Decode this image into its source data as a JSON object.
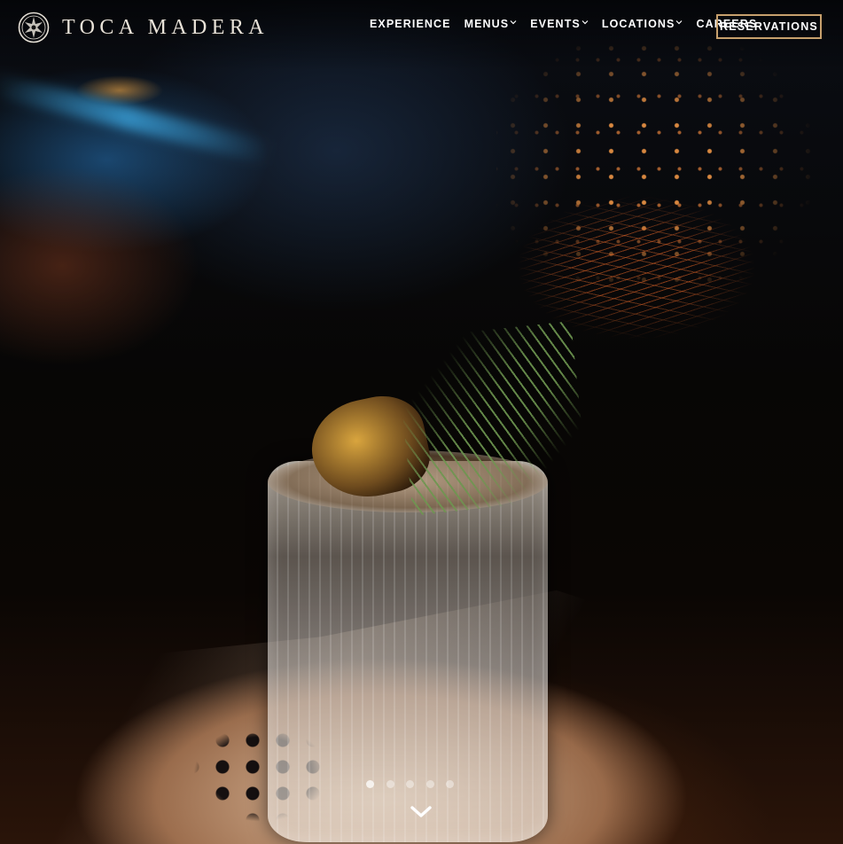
{
  "brand": {
    "name": "TOCA MADERA",
    "logo_icon": "wood-emblem-icon"
  },
  "nav": {
    "items": [
      {
        "label": "EXPERIENCE",
        "has_dropdown": false
      },
      {
        "label": "MENUS",
        "has_dropdown": true
      },
      {
        "label": "EVENTS",
        "has_dropdown": true
      },
      {
        "label": "LOCATIONS",
        "has_dropdown": true
      },
      {
        "label": "CAREERS",
        "has_dropdown": false
      }
    ],
    "cta_label": "RESERVATIONS",
    "cta_border_color": "#c7a06d"
  },
  "hero": {
    "image_subject": "cocktail-with-rosemary-and-sparks",
    "slides_count": 5,
    "active_slide": 1,
    "scroll_icon": "chevron-down-icon"
  }
}
